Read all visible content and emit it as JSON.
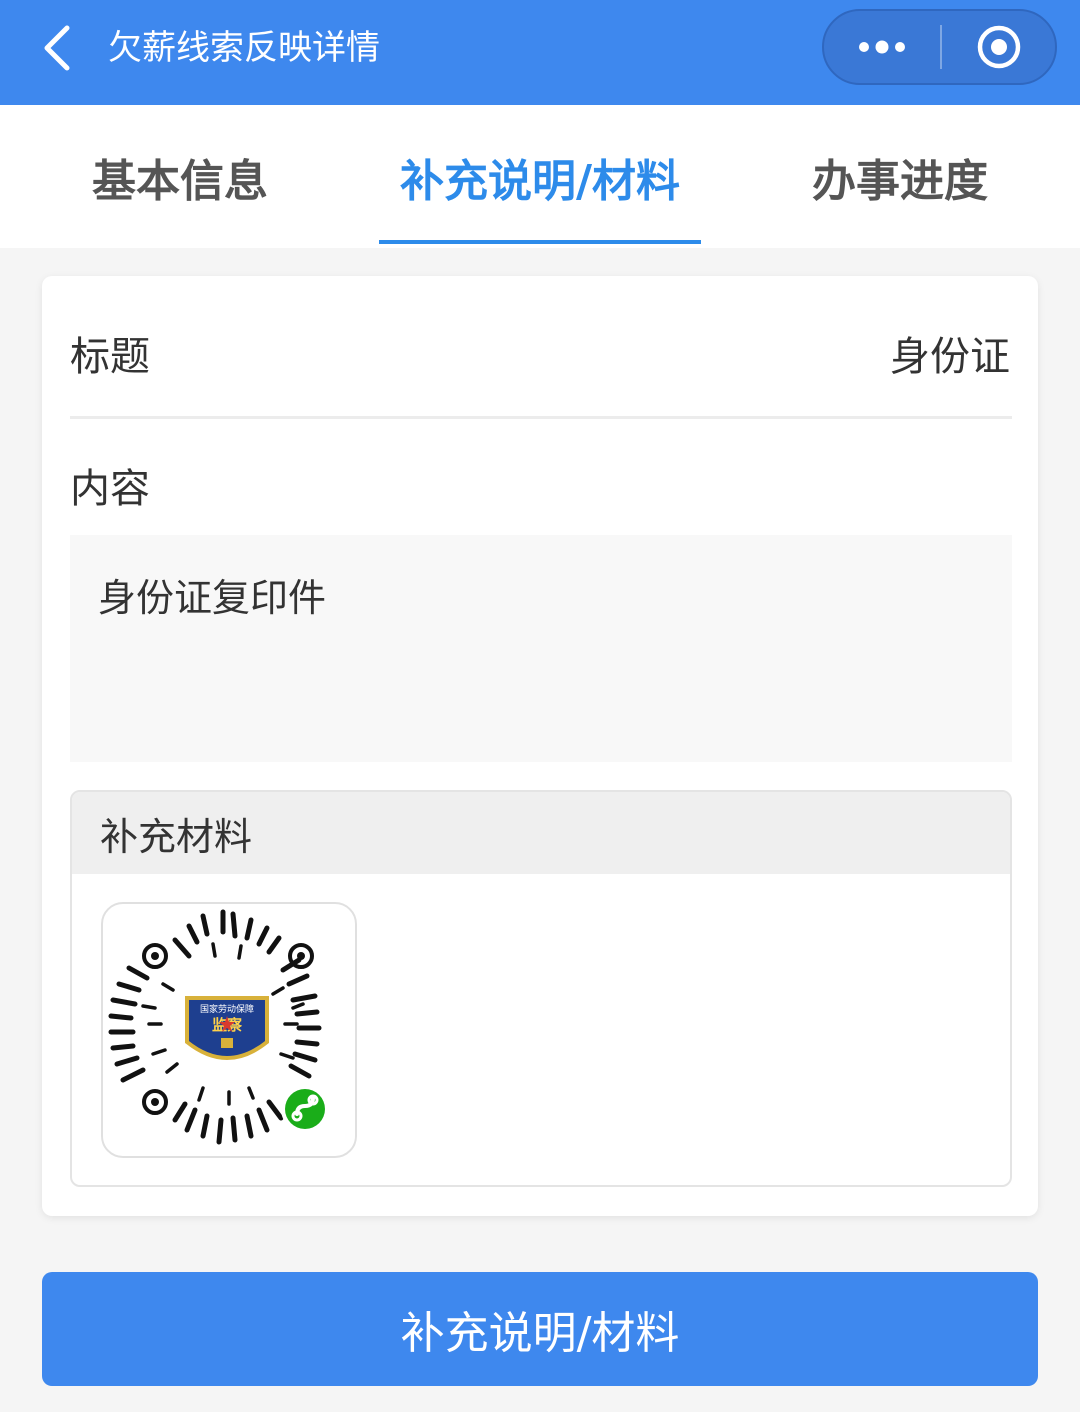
{
  "navbar": {
    "title": "欠薪线索反映详情",
    "back_icon": "chevron-left-icon",
    "more_icon": "more-dots-icon",
    "close_icon": "target-circle-icon",
    "color": "#3e88ee"
  },
  "tabs": [
    {
      "label": "基本信息",
      "active": false
    },
    {
      "label": "补充说明/材料",
      "active": true
    },
    {
      "label": "办事进度",
      "active": false
    }
  ],
  "accent_color": "#2d8bea",
  "detail": {
    "title_label": "标题",
    "title_value": "身份证",
    "content_label": "内容",
    "content_value": "身份证复印件",
    "material_header": "补充材料",
    "material_thumb_icon": "mini-program-qr-code-image",
    "qr_badge_text": "国家劳动保障",
    "qr_seal_text": "监察"
  },
  "submit": {
    "label": "补充说明/材料"
  }
}
